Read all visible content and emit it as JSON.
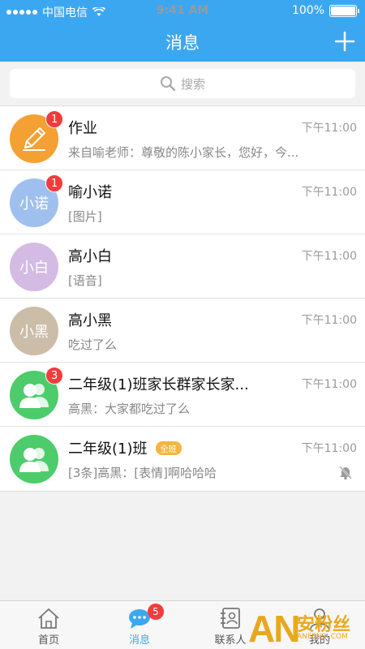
{
  "status_bar": {
    "carrier": "中国电信",
    "time": "9:41 AM",
    "battery": "100%"
  },
  "nav": {
    "title": "消息",
    "add_icon": "plus-icon"
  },
  "search": {
    "placeholder": "搜索",
    "icon": "search-icon"
  },
  "conversations": [
    {
      "name": "作业",
      "preview": "来自喻老师：尊敬的陈小家长，您好，今...",
      "time": "下午11:00",
      "badge": "1",
      "avatar_text": "",
      "avatar_icon": "pencil-icon",
      "avatar_color": "#f5a033"
    },
    {
      "name": "喻小诺",
      "preview": "[图片]",
      "time": "下午11:00",
      "badge": "1",
      "avatar_text": "小诺",
      "avatar_color": "#9fc0ee"
    },
    {
      "name": "高小白",
      "preview": "[语音]",
      "time": "下午11:00",
      "badge": "",
      "avatar_text": "小白",
      "avatar_color": "#d3bbe4"
    },
    {
      "name": "高小黑",
      "preview": "吃过了么",
      "time": "下午11:00",
      "badge": "",
      "avatar_text": "小黑",
      "avatar_color": "#cbbda8"
    },
    {
      "name": "二年级(1)班家长群家长家...",
      "preview": "高黑：大家都吃过了么",
      "time": "下午11:00",
      "badge": "3",
      "avatar_text": "",
      "avatar_icon": "group-icon",
      "avatar_color": "#4ccc6a"
    },
    {
      "name": "二年级(1)班",
      "tag": "全班",
      "preview": "[3条]高黑：[表情]啊哈哈哈",
      "time": "下午11:00",
      "badge": "",
      "avatar_text": "",
      "avatar_icon": "group-icon",
      "avatar_color": "#4ccc6a",
      "muted": true
    }
  ],
  "tabs": [
    {
      "label": "首页",
      "icon": "home-icon"
    },
    {
      "label": "消息",
      "icon": "message-icon",
      "badge": "5",
      "active": true
    },
    {
      "label": "联系人",
      "icon": "contacts-icon"
    },
    {
      "label": "我的",
      "icon": "profile-icon"
    }
  ],
  "watermark": {
    "logo": "AN",
    "name": "安粉丝",
    "url": "ANFENSI.COM"
  },
  "colors": {
    "primary": "#3ca7f1",
    "badge": "#f23b3b",
    "tag": "#f3b642"
  }
}
